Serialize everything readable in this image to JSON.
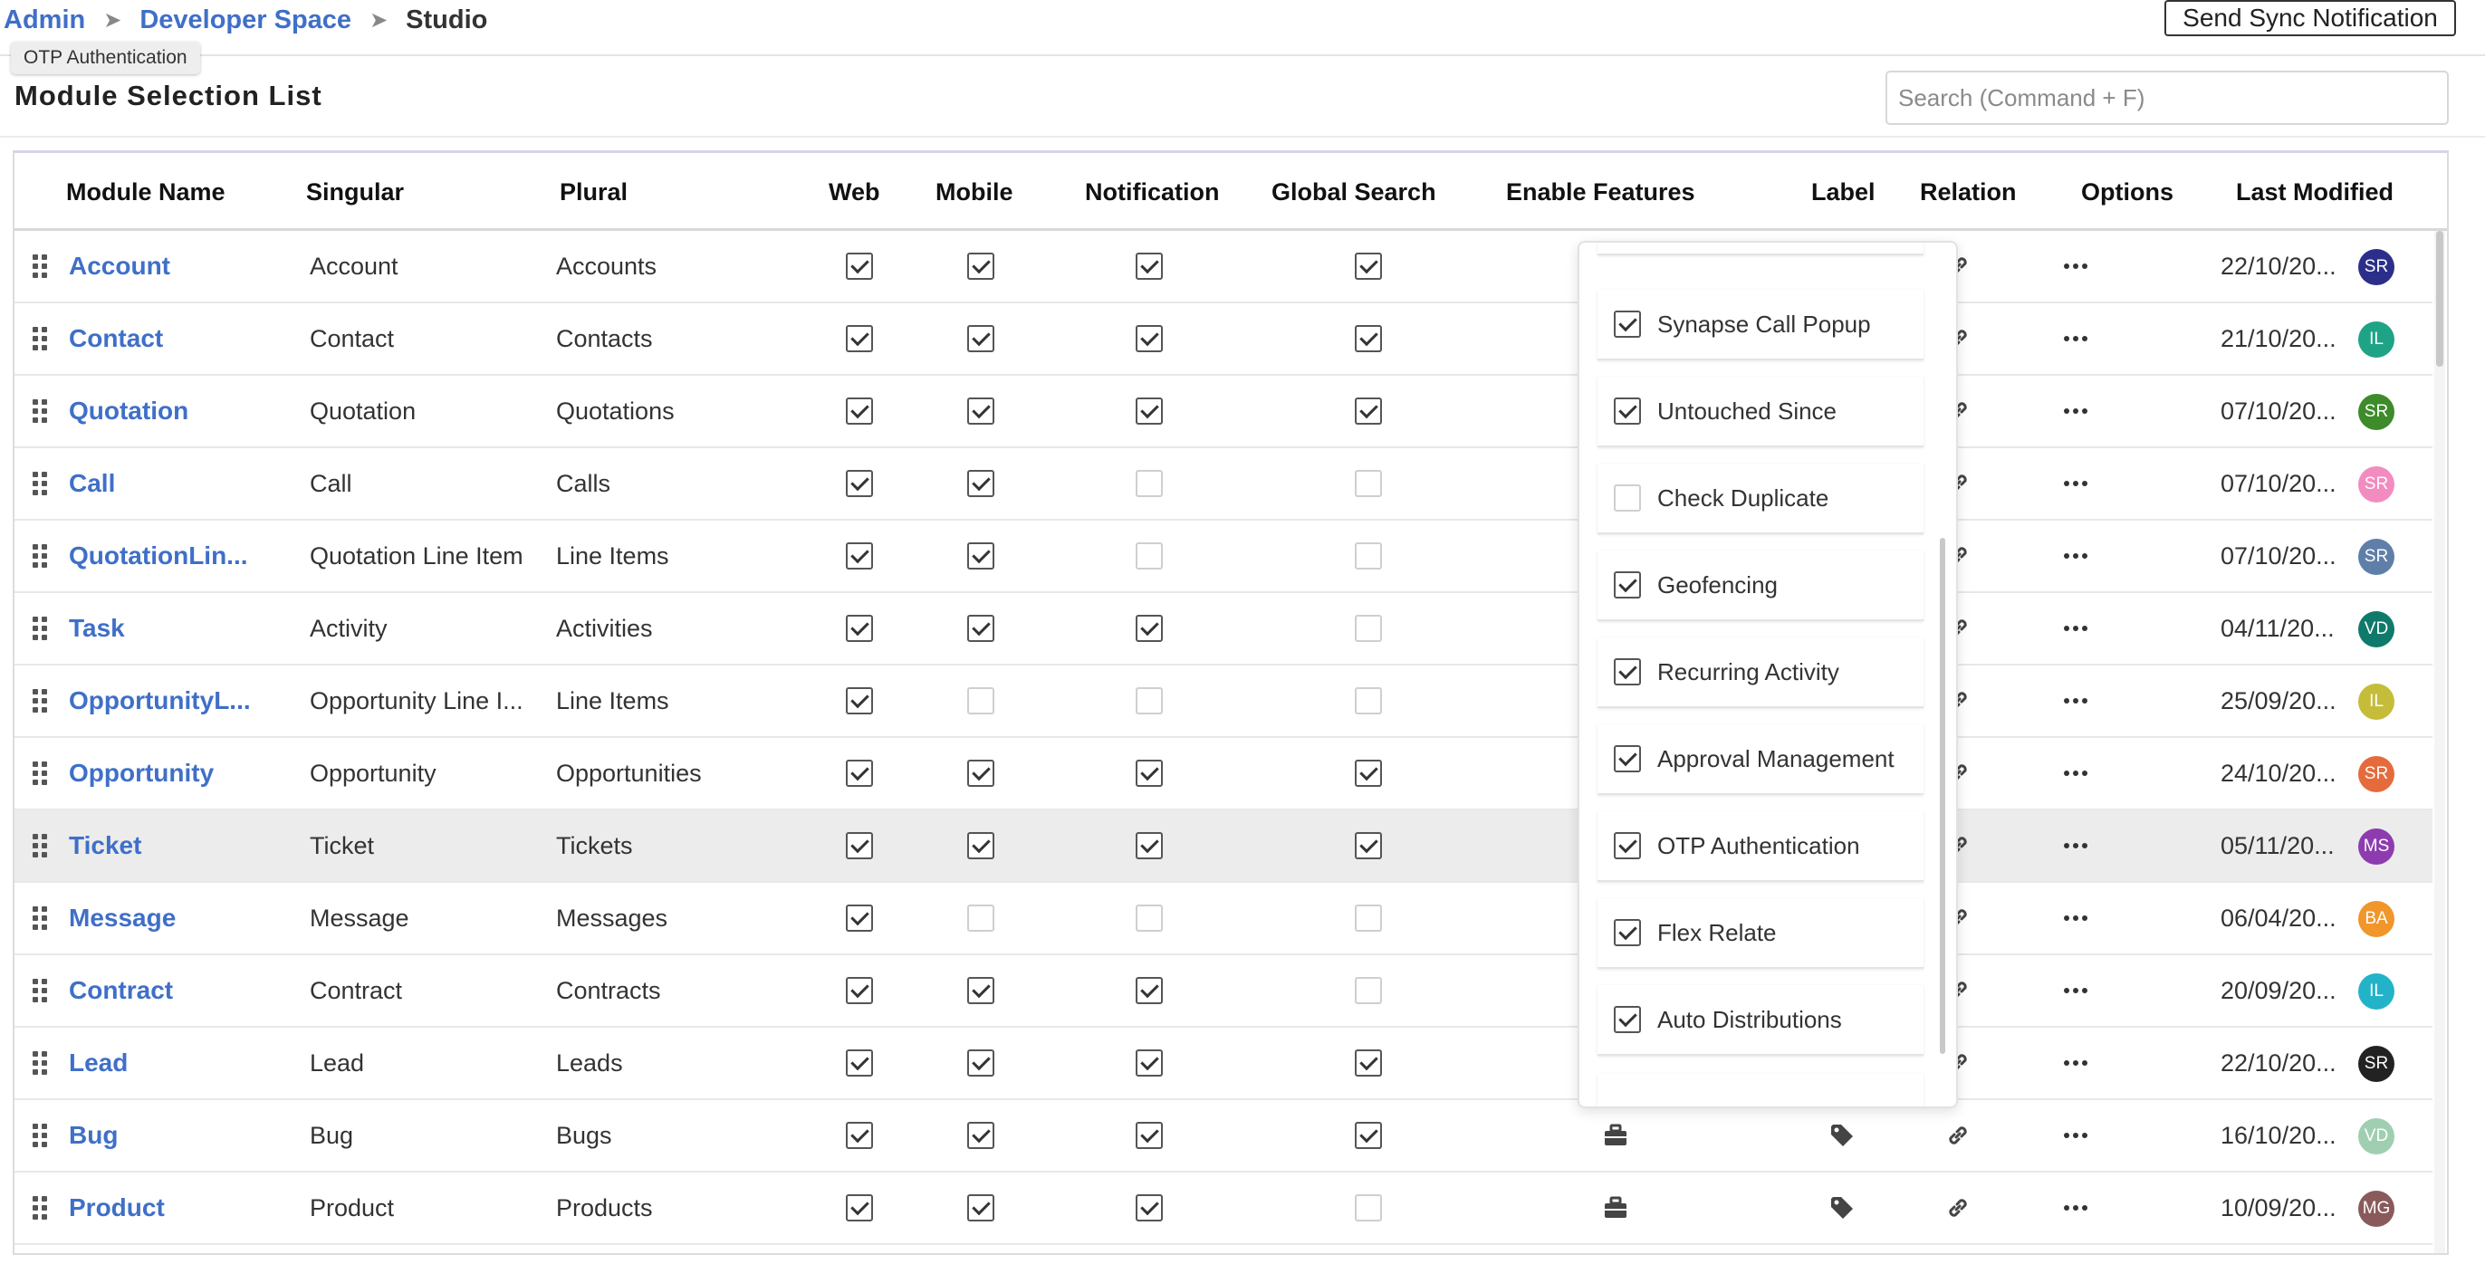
{
  "breadcrumb": {
    "admin": "Admin",
    "developer_space": "Developer Space",
    "current": "Studio"
  },
  "header": {
    "sync_button": "Send Sync Notification"
  },
  "tooltip": {
    "text": "OTP Authentication"
  },
  "page": {
    "title": "Module Selection List"
  },
  "search": {
    "placeholder": "Search (Command + F)"
  },
  "table": {
    "columns": [
      "Module Name",
      "Singular",
      "Plural",
      "Web",
      "Mobile",
      "Notification",
      "Global Search",
      "Enable Features",
      "Label",
      "Relation",
      "Options",
      "Last Modified"
    ],
    "rows": [
      {
        "name": "Account",
        "singular": "Account",
        "plural": "Accounts",
        "web": true,
        "mobile": true,
        "notification": true,
        "global_search": true,
        "modified": "22/10/20...",
        "avatar": "SR",
        "avatar_color": "#2b2f8a"
      },
      {
        "name": "Contact",
        "singular": "Contact",
        "plural": "Contacts",
        "web": true,
        "mobile": true,
        "notification": true,
        "global_search": true,
        "modified": "21/10/20...",
        "avatar": "IL",
        "avatar_color": "#1fa386"
      },
      {
        "name": "Quotation",
        "singular": "Quotation",
        "plural": "Quotations",
        "web": true,
        "mobile": true,
        "notification": true,
        "global_search": true,
        "modified": "07/10/20...",
        "avatar": "SR",
        "avatar_color": "#3d8b2a"
      },
      {
        "name": "Call",
        "singular": "Call",
        "plural": "Calls",
        "web": true,
        "mobile": true,
        "notification": false,
        "global_search": false,
        "modified": "07/10/20...",
        "avatar": "SR",
        "avatar_color": "#f28cc0"
      },
      {
        "name": "QuotationLin...",
        "singular": "Quotation Line Item",
        "plural": "Line Items",
        "web": true,
        "mobile": true,
        "notification": false,
        "global_search": false,
        "modified": "07/10/20...",
        "avatar": "SR",
        "avatar_color": "#5f7fa8"
      },
      {
        "name": "Task",
        "singular": "Activity",
        "plural": "Activities",
        "web": true,
        "mobile": true,
        "notification": true,
        "global_search": false,
        "modified": "04/11/20...",
        "avatar": "VD",
        "avatar_color": "#0f7a6b"
      },
      {
        "name": "OpportunityL...",
        "singular": "Opportunity Line I...",
        "plural": "Line Items",
        "web": true,
        "mobile": false,
        "notification": false,
        "global_search": false,
        "modified": "25/09/20...",
        "avatar": "IL",
        "avatar_color": "#c5bc3a"
      },
      {
        "name": "Opportunity",
        "singular": "Opportunity",
        "plural": "Opportunities",
        "web": true,
        "mobile": true,
        "notification": true,
        "global_search": true,
        "modified": "24/10/20...",
        "avatar": "SR",
        "avatar_color": "#e56b3c"
      },
      {
        "name": "Ticket",
        "singular": "Ticket",
        "plural": "Tickets",
        "web": true,
        "mobile": true,
        "notification": true,
        "global_search": true,
        "modified": "05/11/20...",
        "avatar": "MS",
        "avatar_color": "#8e3bb0"
      },
      {
        "name": "Message",
        "singular": "Message",
        "plural": "Messages",
        "web": true,
        "mobile": false,
        "notification": false,
        "global_search": false,
        "modified": "06/04/20...",
        "avatar": "BA",
        "avatar_color": "#f0962a"
      },
      {
        "name": "Contract",
        "singular": "Contract",
        "plural": "Contracts",
        "web": true,
        "mobile": true,
        "notification": true,
        "global_search": false,
        "modified": "20/09/20...",
        "avatar": "IL",
        "avatar_color": "#22b3c9"
      },
      {
        "name": "Lead",
        "singular": "Lead",
        "plural": "Leads",
        "web": true,
        "mobile": true,
        "notification": true,
        "global_search": true,
        "modified": "22/10/20...",
        "avatar": "SR",
        "avatar_color": "#222222"
      },
      {
        "name": "Bug",
        "singular": "Bug",
        "plural": "Bugs",
        "web": true,
        "mobile": true,
        "notification": true,
        "global_search": true,
        "modified": "16/10/20...",
        "avatar": "VD",
        "avatar_color": "#9fcfb0"
      },
      {
        "name": "Product",
        "singular": "Product",
        "plural": "Products",
        "web": true,
        "mobile": true,
        "notification": true,
        "global_search": false,
        "modified": "10/09/20...",
        "avatar": "MG",
        "avatar_color": "#8a5a5a"
      }
    ],
    "highlighted_row": 8
  },
  "features_popover": {
    "items": [
      {
        "label": "Synapse Call Popup",
        "checked": true
      },
      {
        "label": "Untouched Since",
        "checked": true
      },
      {
        "label": "Check Duplicate",
        "checked": false
      },
      {
        "label": "Geofencing",
        "checked": true
      },
      {
        "label": "Recurring Activity",
        "checked": true
      },
      {
        "label": "Approval Management",
        "checked": true
      },
      {
        "label": "OTP Authentication",
        "checked": true
      },
      {
        "label": "Flex Relate",
        "checked": true
      },
      {
        "label": "Auto Distributions",
        "checked": true
      }
    ]
  },
  "icons": {
    "features": "toolbox-icon",
    "label": "tag-icon",
    "relation": "link-icon",
    "options": "more-options-icon",
    "drag": "drag-handle-icon",
    "breadcrumb_separator": "chevron-right-icon"
  }
}
